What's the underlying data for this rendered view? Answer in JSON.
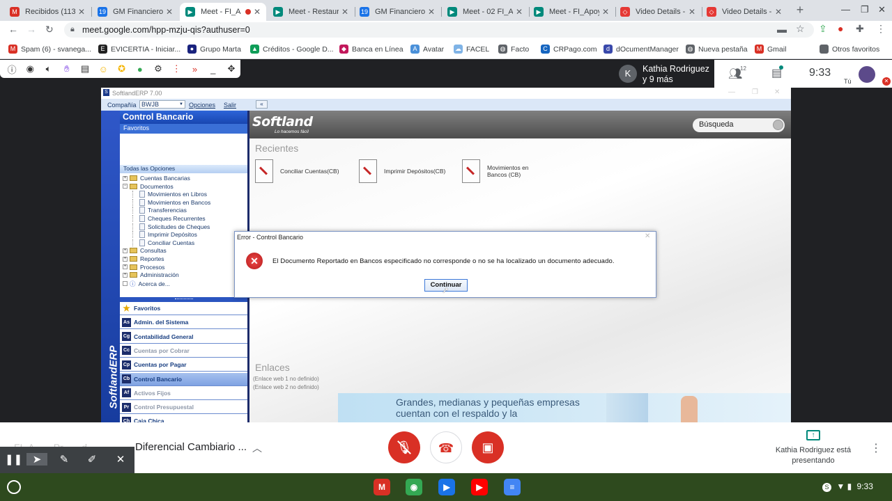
{
  "browser": {
    "tabs": [
      {
        "label": "Recibidos (113) - ",
        "icon": "gmail-icon",
        "color": "#d93025",
        "glyph": "M",
        "active": false
      },
      {
        "label": "GM Financiero - ",
        "icon": "calendar-icon",
        "color": "#1a73e8",
        "glyph": "19",
        "active": false
      },
      {
        "label": "Meet - FI_A",
        "icon": "meet-icon",
        "color": "#00897b",
        "glyph": "▶",
        "active": true
      },
      {
        "label": "Meet - Restaura",
        "icon": "meet-icon",
        "color": "#00897b",
        "glyph": "▶",
        "active": false
      },
      {
        "label": "GM Financiero - ",
        "icon": "calendar-icon",
        "color": "#1a73e8",
        "glyph": "19",
        "active": false
      },
      {
        "label": "Meet - 02 FI_Ap",
        "icon": "meet-icon",
        "color": "#00897b",
        "glyph": "▶",
        "active": false
      },
      {
        "label": "Meet - FI_Apoyo",
        "icon": "meet-icon",
        "color": "#00897b",
        "glyph": "▶",
        "active": false
      },
      {
        "label": "Video Details - S",
        "icon": "studio-icon",
        "color": "#e53935",
        "glyph": "◇",
        "active": false
      },
      {
        "label": "Video Details - S",
        "icon": "studio-icon",
        "color": "#e53935",
        "glyph": "◇",
        "active": false
      }
    ],
    "url": "meet.google.com/hpp-mzju-qis?authuser=0",
    "bookmarks": [
      {
        "label": "Spam (6) - svanega...",
        "color": "#d93025",
        "glyph": "M"
      },
      {
        "label": "EVICERTIA - Iniciar...",
        "color": "#222222",
        "glyph": "E"
      },
      {
        "label": "Grupo Marta",
        "color": "#1a237e",
        "glyph": "●"
      },
      {
        "label": "Créditos - Google D...",
        "color": "#0f9d58",
        "glyph": "▲"
      },
      {
        "label": "Banca en Línea",
        "color": "#c2185b",
        "glyph": "◆"
      },
      {
        "label": "Avatar",
        "color": "#4a90d9",
        "glyph": "A"
      },
      {
        "label": "FACEL",
        "color": "#7fb3e6",
        "glyph": "☁"
      },
      {
        "label": "Facto",
        "color": "#5f6368",
        "glyph": "◍"
      },
      {
        "label": "CRPago.com",
        "color": "#1565c0",
        "glyph": "C"
      },
      {
        "label": "dOcumentManager",
        "color": "#3949ab",
        "glyph": "d"
      },
      {
        "label": "Nueva pestaña",
        "color": "#5f6368",
        "glyph": "◍"
      },
      {
        "label": "Gmail",
        "color": "#d93025",
        "glyph": "M"
      }
    ],
    "other_bookmarks": "Otros favoritos"
  },
  "meet": {
    "speaker_initial": "K",
    "speaker_name": "Kathia Rodriguez",
    "speaker_others": "y 9 más",
    "participant_count": "12",
    "clock": "9:33",
    "self_label": "Tú",
    "presentation_pretitle": "FI_A... ...Pr... ...d",
    "meeting_title": "Diferencial Cambiario ...",
    "presenter_text": "Kathia Rodriguez está presentando"
  },
  "erp": {
    "window_title": "SoftlandERP 7.00",
    "menu": {
      "compania_label": "Compañía",
      "compania_value": "BWJB",
      "opciones": "Opciones",
      "salir": "Salir"
    },
    "module_header": "Control Bancario",
    "favoritos_label": "Favoritos",
    "todas_label": "Todas las Opciones",
    "tree": [
      {
        "label": "Cuentas Bancarias",
        "level": 0,
        "kind": "folder",
        "exp": "+"
      },
      {
        "label": "Documentos",
        "level": 0,
        "kind": "folder",
        "exp": "−"
      },
      {
        "label": "Movimientos en Libros",
        "level": 1,
        "kind": "doc"
      },
      {
        "label": "Movimientos en Bancos",
        "level": 1,
        "kind": "doc"
      },
      {
        "label": "Transferencias",
        "level": 1,
        "kind": "doc"
      },
      {
        "label": "Cheques Recurrentes",
        "level": 1,
        "kind": "doc"
      },
      {
        "label": "Solicitudes de Cheques",
        "level": 1,
        "kind": "doc"
      },
      {
        "label": "Imprimir Depósitos",
        "level": 1,
        "kind": "doc"
      },
      {
        "label": "Conciliar Cuentas",
        "level": 1,
        "kind": "doc"
      },
      {
        "label": "Consultas",
        "level": 0,
        "kind": "folder",
        "exp": "+"
      },
      {
        "label": "Reportes",
        "level": 0,
        "kind": "folder",
        "exp": "+"
      },
      {
        "label": "Procesos",
        "level": 0,
        "kind": "folder",
        "exp": "+"
      },
      {
        "label": "Administración",
        "level": 0,
        "kind": "folder",
        "exp": "+"
      },
      {
        "label": "Acerca de...",
        "level": 0,
        "kind": "info",
        "exp": ""
      }
    ],
    "modules": [
      {
        "code": "★",
        "label": "Favoritos",
        "state": "normal"
      },
      {
        "code": "As",
        "label": "Admin. del Sistema",
        "state": "normal"
      },
      {
        "code": "Cg",
        "label": "Contabilidad General",
        "state": "normal"
      },
      {
        "code": "Cc",
        "label": "Cuentas por Cobrar",
        "state": "disabled"
      },
      {
        "code": "Cp",
        "label": "Cuentas por Pagar",
        "state": "normal"
      },
      {
        "code": "Cb",
        "label": "Control Bancario",
        "state": "selected"
      },
      {
        "code": "Af",
        "label": "Activos Fijos",
        "state": "disabled"
      },
      {
        "code": "Pr",
        "label": "Control Presupuestal",
        "state": "disabled"
      },
      {
        "code": "Ch",
        "label": "Caja Chica",
        "state": "normal"
      }
    ],
    "brand_vertical": "SoftlandERP",
    "logo": "Softland",
    "logo_tagline": "Lo hacemos fácil",
    "search_label": "Búsqueda",
    "recientes_title": "Recientes",
    "recientes": [
      {
        "label": "Conciliar Cuentas(CB)"
      },
      {
        "label": "Imprimir Depósitos(CB)"
      },
      {
        "label": "Movimientos en Bancos (CB)"
      }
    ],
    "enlaces_title": "Enlaces",
    "enlaces": [
      "(Enlace web 1 no definido)",
      "(Enlace web 2 no definido)"
    ],
    "ad_text": "Grandes, medianas y pequeñas empresas cuentan con el respaldo y la"
  },
  "dialog": {
    "title": "Error - Control Bancario",
    "message": "El Documento Reportado en Bancos especificado no corresponde o no se ha localizado un documento adecuado.",
    "button": "Continuar"
  },
  "os": {
    "clock": "9:33",
    "apps": [
      {
        "name": "gmail-app-icon",
        "glyph": "M",
        "color": "#d93025"
      },
      {
        "name": "chrome-app-icon",
        "glyph": "◉",
        "color": "#34a853"
      },
      {
        "name": "play-store-app-icon",
        "glyph": "▶",
        "color": "#1a73e8"
      },
      {
        "name": "youtube-app-icon",
        "glyph": "▶",
        "color": "#ff0000"
      },
      {
        "name": "docs-app-icon",
        "glyph": "≡",
        "color": "#4285f4"
      }
    ]
  }
}
